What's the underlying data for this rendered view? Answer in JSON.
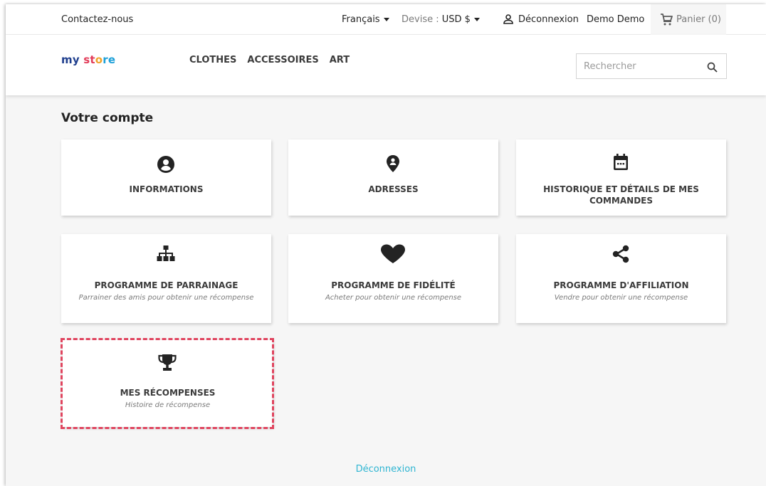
{
  "topbar": {
    "contact": "Contactez-nous",
    "language": "Français",
    "currency_label": "Devise :",
    "currency_value": "USD $",
    "logout": "Déconnexion",
    "username": "Demo Demo",
    "cart": "Panier (0)"
  },
  "header": {
    "logo": {
      "part1": "my",
      "part2": "st",
      "part3": "o",
      "part4": "re"
    },
    "nav": [
      "CLOTHES",
      "ACCESSOIRES",
      "ART"
    ],
    "search_placeholder": "Rechercher"
  },
  "account": {
    "title": "Votre compte",
    "tiles": [
      {
        "icon": "account-circle-icon",
        "title": "INFORMATIONS",
        "subtitle": ""
      },
      {
        "icon": "location-pin-icon",
        "title": "ADRESSES",
        "subtitle": ""
      },
      {
        "icon": "calendar-icon",
        "title": "HISTORIQUE ET DÉTAILS DE MES COMMANDES",
        "subtitle": ""
      },
      {
        "icon": "sitemap-icon",
        "title": "PROGRAMME DE PARRAINAGE",
        "subtitle": "Parrainer des amis pour obtenir une récompense"
      },
      {
        "icon": "heart-icon",
        "title": "PROGRAMME DE FIDÉLITÉ",
        "subtitle": "Acheter pour obtenir une récompense"
      },
      {
        "icon": "share-icon",
        "title": "PROGRAMME D'AFFILIATION",
        "subtitle": "Vendre pour obtenir une récompense"
      },
      {
        "icon": "trophy-icon",
        "title": "MES RÉCOMPENSES",
        "subtitle": "Histoire de récompense"
      }
    ]
  },
  "footer": {
    "logout": "Déconnexion"
  },
  "colors": {
    "accent": "#2fb5d2",
    "highlight": "#e0455f",
    "text": "#232323"
  }
}
